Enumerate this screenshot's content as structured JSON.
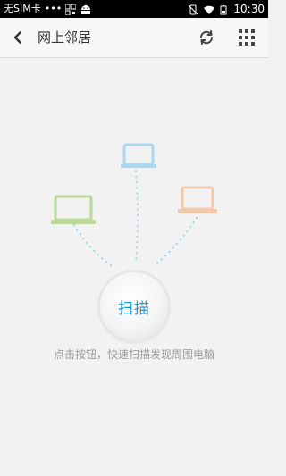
{
  "status_bar": {
    "carrier": "无SIM卡",
    "dots": "•••",
    "time": "10:30"
  },
  "header": {
    "title": "网上邻居"
  },
  "main": {
    "scan_button_label": "扫描",
    "hint": "点击按钮，快速扫描发现周围电脑"
  },
  "colors": {
    "laptop_left": "#b9d89a",
    "laptop_center": "#a9d8f0",
    "laptop_right": "#f0c9a8",
    "dots": "#9fd3ec",
    "accent": "#1e9ad6"
  },
  "icons": {
    "back": "back-arrow-icon",
    "refresh": "refresh-icon",
    "grid": "grid-icon"
  }
}
